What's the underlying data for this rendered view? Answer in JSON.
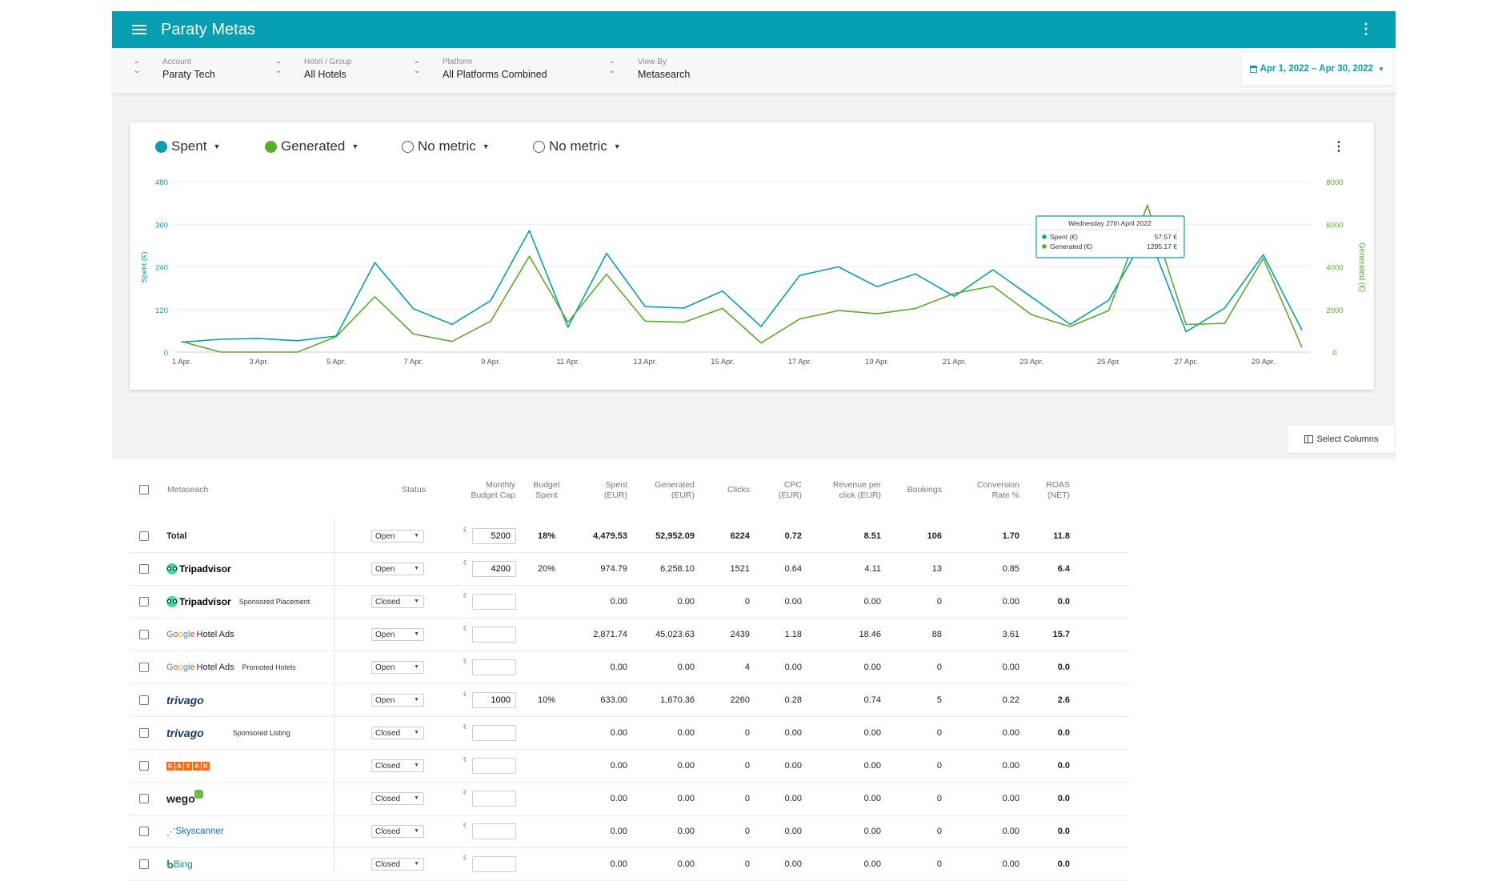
{
  "app": {
    "title": "Paraty Metas"
  },
  "filters": [
    {
      "label": "Account",
      "value": "Paraty Tech"
    },
    {
      "label": "Hotel / Group",
      "value": "All Hotels"
    },
    {
      "label": "Platform",
      "value": "All Platforms Combined"
    },
    {
      "label": "View By",
      "value": "Metasearch"
    }
  ],
  "date_range": "Apr 1, 2022 – Apr 30, 2022",
  "metrics": [
    {
      "label": "Spent",
      "color": "#069eb3",
      "active": true
    },
    {
      "label": "Generated",
      "color": "#5aac2a",
      "active": true
    },
    {
      "label": "No metric",
      "color": "#ffffff",
      "active": false
    },
    {
      "label": "No metric",
      "color": "#ffffff",
      "active": false
    }
  ],
  "tooltip": {
    "title": "Wednesday 27th April 2022",
    "rows": [
      {
        "label": "Spent (€)",
        "value": "57.57 €"
      },
      {
        "label": "Generated (€)",
        "value": "1295.17 €"
      }
    ]
  },
  "chart_data": {
    "type": "line",
    "x": [
      "1 Apr.",
      "2 Apr.",
      "3 Apr.",
      "4 Apr.",
      "5 Apr.",
      "6 Apr.",
      "7 Apr.",
      "8 Apr.",
      "9 Apr.",
      "10 Apr.",
      "11 Apr.",
      "12 Apr.",
      "13 Apr.",
      "14 Apr.",
      "15 Apr.",
      "16 Apr.",
      "17 Apr.",
      "18 Apr.",
      "19 Apr.",
      "20 Apr.",
      "21 Apr.",
      "22 Apr.",
      "23 Apr.",
      "24 Apr.",
      "25 Apr.",
      "26 Apr.",
      "27 Apr.",
      "28 Apr.",
      "29 Apr.",
      "30 Apr."
    ],
    "x_tick_labels": [
      "1 Apr.",
      "3 Apr.",
      "5 Apr.",
      "7 Apr.",
      "9 Apr.",
      "11 Apr.",
      "13 Apr.",
      "15 Apr.",
      "17 Apr.",
      "19 Apr.",
      "21 Apr.",
      "23 Apr.",
      "25 Apr.",
      "27 Apr.",
      "29 Apr."
    ],
    "series": [
      {
        "name": "Spent",
        "axis": "left",
        "color": "#069eb3",
        "values": [
          28,
          36,
          38,
          32,
          45,
          252,
          122,
          78,
          145,
          342,
          70,
          278,
          128,
          124,
          172,
          72,
          216,
          240,
          184,
          220,
          157,
          232,
          155,
          78,
          146,
          338,
          57,
          124,
          274,
          62
        ]
      },
      {
        "name": "Generated",
        "axis": "right",
        "color": "#5aac2a",
        "values": [
          500,
          0,
          0,
          0,
          720,
          2600,
          850,
          500,
          1450,
          4500,
          1400,
          3650,
          1450,
          1400,
          2050,
          430,
          1550,
          1950,
          1800,
          2050,
          2750,
          3100,
          1750,
          1200,
          1950,
          6900,
          1295,
          1350,
          4400,
          220
        ]
      }
    ],
    "ylabel": "Spent (€)",
    "y2label": "Generated (€)",
    "ylim": [
      0,
      480
    ],
    "y2lim": [
      0,
      8000
    ],
    "yticks": [
      "0",
      "120",
      "240",
      "360",
      "480"
    ],
    "y2ticks": [
      "0",
      "2000",
      "4000",
      "6000",
      "8000"
    ],
    "grid": true
  },
  "select_columns": "Select Columns",
  "table": {
    "headers": [
      "Metaseach",
      "Status",
      "Monthly Budget Cap",
      "Budget Spent",
      "Spent (EUR)",
      "Generated (EUR)",
      "Clicks",
      "CPC (EUR)",
      "Revenue per click (EUR)",
      "Bookings",
      "Conversion Rate %",
      "ROAS (NET)"
    ],
    "currency_symbol": "€",
    "status_options": [
      "Open",
      "Closed"
    ],
    "rows": [
      {
        "name": "Total",
        "logo": "text",
        "sub": "",
        "status": "Open",
        "budget_cap": "5200",
        "budget_spent": "18%",
        "spent": "4,479.53",
        "generated": "52,952.09",
        "clicks": "6224",
        "cpc": "0.72",
        "rpc": "8.51",
        "bookings": "106",
        "conv": "1.70",
        "roas": "11.8"
      },
      {
        "name": "Tripadvisor",
        "logo": "tripadvisor",
        "sub": "",
        "status": "Open",
        "budget_cap": "4200",
        "budget_spent": "20%",
        "spent": "974.79",
        "generated": "6,258.10",
        "clicks": "1521",
        "cpc": "0.64",
        "rpc": "4.11",
        "bookings": "13",
        "conv": "0.85",
        "roas": "6.4"
      },
      {
        "name": "Tripadvisor",
        "logo": "tripadvisor",
        "sub": "Sponsored Placement",
        "status": "Closed",
        "budget_cap": "",
        "budget_spent": "",
        "spent": "0.00",
        "generated": "0.00",
        "clicks": "0",
        "cpc": "0.00",
        "rpc": "0.00",
        "bookings": "0",
        "conv": "0.00",
        "roas": "0.0"
      },
      {
        "name": "Hotel Ads",
        "logo": "google",
        "sub": "",
        "status": "Open",
        "budget_cap": "",
        "budget_spent": "",
        "spent": "2,871.74",
        "generated": "45,023.63",
        "clicks": "2439",
        "cpc": "1.18",
        "rpc": "18.46",
        "bookings": "88",
        "conv": "3.61",
        "roas": "15.7"
      },
      {
        "name": "Hotel Ads",
        "logo": "google",
        "sub": "Promoted Hotels",
        "status": "Open",
        "budget_cap": "",
        "budget_spent": "",
        "spent": "0.00",
        "generated": "0.00",
        "clicks": "4",
        "cpc": "0.00",
        "rpc": "0.00",
        "bookings": "0",
        "conv": "0.00",
        "roas": "0.0"
      },
      {
        "name": "trivago",
        "logo": "trivago",
        "sub": "",
        "status": "Open",
        "budget_cap": "1000",
        "budget_spent": "10%",
        "spent": "633.00",
        "generated": "1,670.36",
        "clicks": "2260",
        "cpc": "0.28",
        "rpc": "0.74",
        "bookings": "5",
        "conv": "0.22",
        "roas": "2.6"
      },
      {
        "name": "trivago",
        "logo": "trivago",
        "sub": "Sponsored Listing",
        "status": "Closed",
        "budget_cap": "",
        "budget_spent": "",
        "spent": "0.00",
        "generated": "0.00",
        "clicks": "0",
        "cpc": "0.00",
        "rpc": "0.00",
        "bookings": "0",
        "conv": "0.00",
        "roas": "0.0"
      },
      {
        "name": "KAYAK",
        "logo": "kayak",
        "sub": "",
        "status": "Closed",
        "budget_cap": "",
        "budget_spent": "",
        "spent": "0.00",
        "generated": "0.00",
        "clicks": "0",
        "cpc": "0.00",
        "rpc": "0.00",
        "bookings": "0",
        "conv": "0.00",
        "roas": "0.0"
      },
      {
        "name": "wego",
        "logo": "wego",
        "sub": "",
        "status": "Closed",
        "budget_cap": "",
        "budget_spent": "",
        "spent": "0.00",
        "generated": "0.00",
        "clicks": "0",
        "cpc": "0.00",
        "rpc": "0.00",
        "bookings": "0",
        "conv": "0.00",
        "roas": "0.0"
      },
      {
        "name": "Skyscanner",
        "logo": "skyscanner",
        "sub": "",
        "status": "Closed",
        "budget_cap": "",
        "budget_spent": "",
        "spent": "0.00",
        "generated": "0.00",
        "clicks": "0",
        "cpc": "0.00",
        "rpc": "0.00",
        "bookings": "0",
        "conv": "0.00",
        "roas": "0.0"
      },
      {
        "name": "Bing",
        "logo": "bing",
        "sub": "",
        "status": "Closed",
        "budget_cap": "",
        "budget_spent": "",
        "spent": "0.00",
        "generated": "0.00",
        "clicks": "0",
        "cpc": "0.00",
        "rpc": "0.00",
        "bookings": "0",
        "conv": "0.00",
        "roas": "0.0"
      }
    ]
  }
}
